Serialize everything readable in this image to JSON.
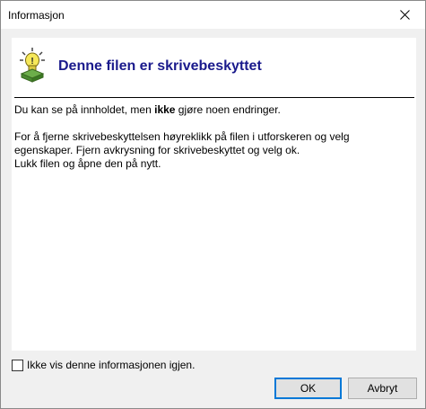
{
  "window": {
    "title": "Informasjon"
  },
  "header": {
    "title": "Denne filen er skrivebeskyttet",
    "icon": "lightbulb-info-icon"
  },
  "body": {
    "line1_before": "Du kan se på innholdet, men ",
    "line1_bold": "ikke",
    "line1_after": " gjøre noen endringer.",
    "para2_line1": "For å fjerne skrivebeskyttelsen høyreklikk på filen i utforskeren og velg",
    "para2_line2": "egenskaper. Fjern avkrysning for skrivebeskyttet og velg ok.",
    "para2_line3": "Lukk filen og åpne den på nytt."
  },
  "footer": {
    "checkbox_label": "Ikke vis denne informasjonen igjen.",
    "checkbox_checked": false,
    "ok_label": "OK",
    "cancel_label": "Avbryt"
  },
  "colors": {
    "accent": "#0078d7",
    "title": "#1a1a8c"
  }
}
